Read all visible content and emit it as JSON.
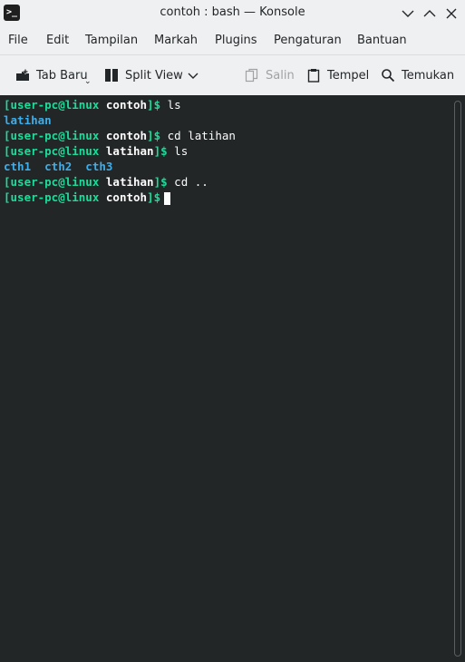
{
  "window": {
    "title": "contoh : bash — Konsole",
    "app_icon_text": ">_"
  },
  "menu": [
    "File",
    "Edit",
    "Tampilan",
    "Markah",
    "Plugins",
    "Pengaturan",
    "Bantuan"
  ],
  "toolbar": {
    "tab_baru": "Tab Baru",
    "split_view": "Split View",
    "salin": "Salin",
    "tempel": "Tempel",
    "temukan": "Temukan"
  },
  "terminal": {
    "lines": [
      {
        "user": "[user-pc@linux",
        "dir": "contoh",
        "end": "]$",
        "cmd": " ls"
      },
      {
        "output": "latihan"
      },
      {
        "user": "[user-pc@linux",
        "dir": "contoh",
        "end": "]$",
        "cmd": " cd latihan"
      },
      {
        "user": "[user-pc@linux",
        "dir": "latihan",
        "end": "]$",
        "cmd": " ls"
      },
      {
        "output": "cth1  cth2  cth3"
      },
      {
        "user": "[user-pc@linux",
        "dir": "latihan",
        "end": "]$",
        "cmd": " cd .."
      },
      {
        "user": "[user-pc@linux",
        "dir": "contoh",
        "end": "]$",
        "cmd": ""
      }
    ]
  },
  "colors": {
    "terminal_bg": "#232627",
    "prompt_green": "#1cdc9a",
    "dir_blue": "#3daee9"
  }
}
